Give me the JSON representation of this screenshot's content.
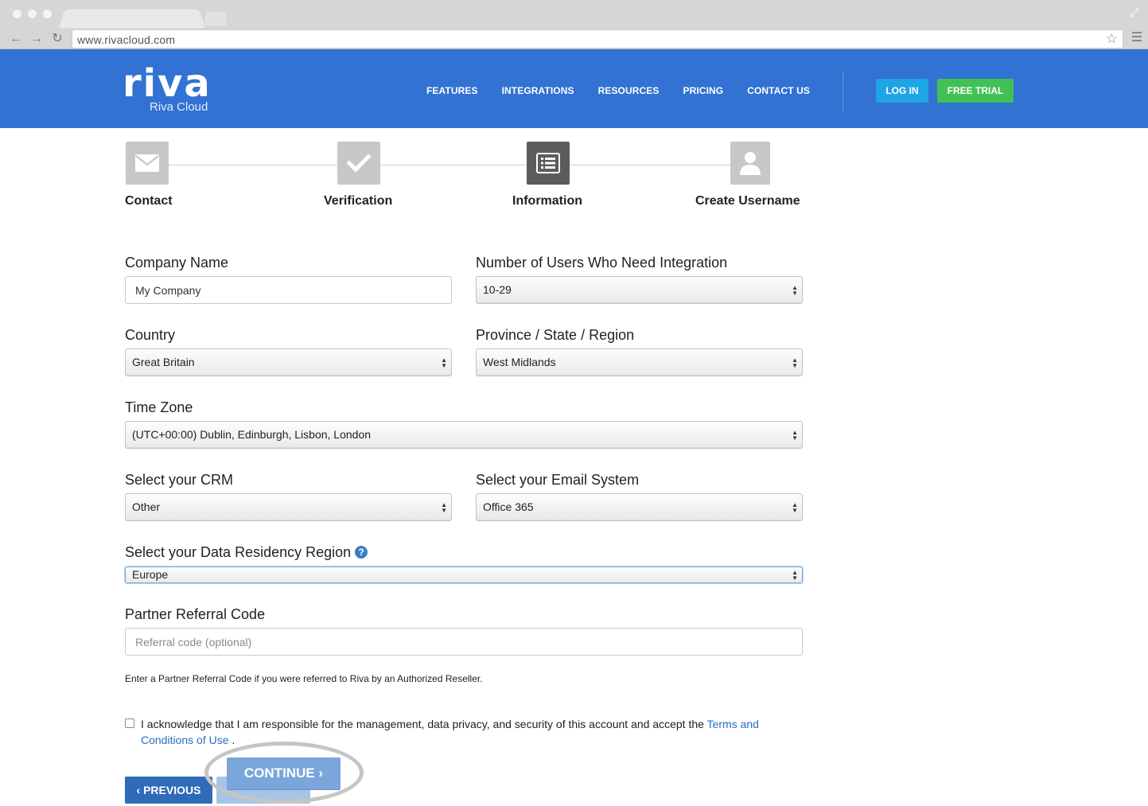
{
  "browser": {
    "url": "www.rivacloud.com",
    "nav_back": "←",
    "nav_forward": "→",
    "nav_reload": "↻",
    "fullscreen_glyph": "⤢",
    "star_glyph": "☆"
  },
  "header": {
    "logo_text": "riva",
    "logo_subtitle": "Riva Cloud",
    "nav": [
      "FEATURES",
      "INTEGRATIONS",
      "RESOURCES",
      "PRICING",
      "CONTACT US"
    ],
    "login_label": "LOG IN",
    "trial_label": "FREE TRIAL",
    "colors": {
      "header_bg": "#3172d3",
      "login_bg": "#1ea5e6",
      "trial_bg": "#41c155"
    }
  },
  "steps": [
    {
      "label": "Contact",
      "icon": "envelope-icon",
      "state": "inactive"
    },
    {
      "label": "Verification",
      "icon": "checkmark-icon",
      "state": "inactive"
    },
    {
      "label": "Information",
      "icon": "list-icon",
      "state": "active"
    },
    {
      "label": "Create Username",
      "icon": "user-icon",
      "state": "inactive"
    }
  ],
  "form": {
    "company_name": {
      "label": "Company Name",
      "value": "My Company"
    },
    "num_users": {
      "label": "Number of Users Who Need Integration",
      "value": "10-29"
    },
    "country": {
      "label": "Country",
      "value": "Great Britain"
    },
    "province": {
      "label": "Province / State / Region",
      "value": "West Midlands"
    },
    "time_zone": {
      "label": "Time Zone",
      "value": "(UTC+00:00) Dublin, Edinburgh, Lisbon, London"
    },
    "crm": {
      "label": "Select your CRM",
      "value": "Other"
    },
    "email_system": {
      "label": "Select your Email System",
      "value": "Office 365"
    },
    "data_residency": {
      "label": "Select your Data Residency Region",
      "value": "Europe",
      "help_glyph": "?"
    },
    "referral": {
      "label": "Partner Referral Code",
      "placeholder": "Referral code (optional)",
      "hint": "Enter a Partner Referral Code if you were referred to Riva by an Authorized Reseller."
    },
    "acknowledge": {
      "text": "I acknowledge that I am responsible for the management, data privacy, and security of this account and accept the",
      "link": "Terms and Conditions of Use",
      "suffix": "."
    }
  },
  "actions": {
    "previous_label": "PREVIOUS",
    "previous_glyph": "‹",
    "continue_label": "CONTINUE",
    "continue_glyph": "›"
  }
}
